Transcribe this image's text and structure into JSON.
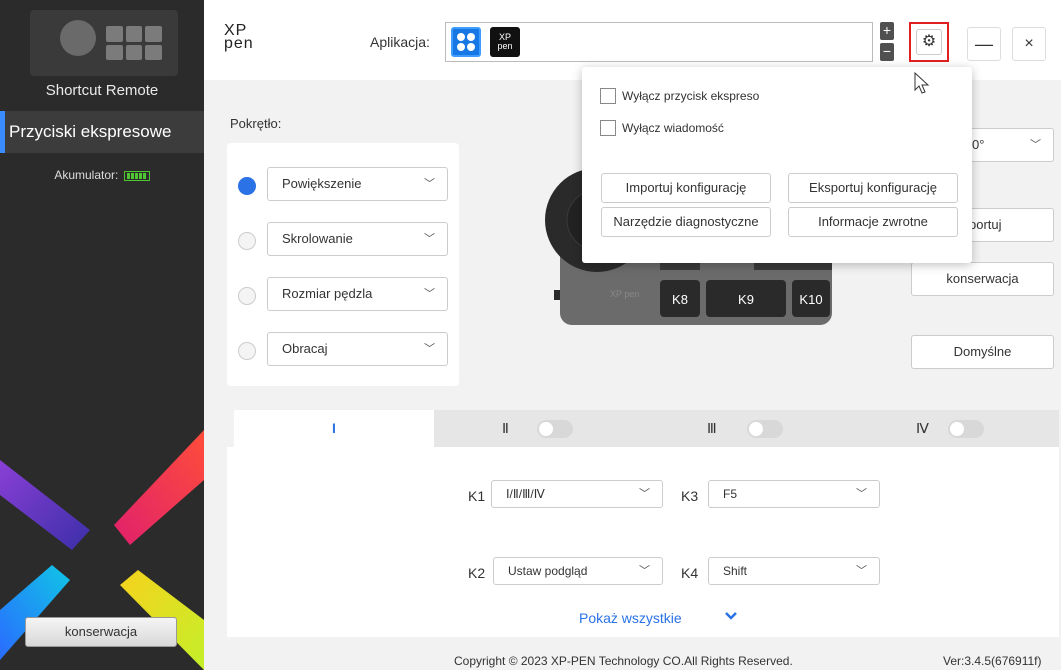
{
  "sidebar": {
    "device_name": "Shortcut Remote",
    "nav_item": "Przyciski ekspresowe",
    "battery_label": "Akumulator:",
    "maintenance_button": "konserwacja"
  },
  "header": {
    "logo_line1": "XP",
    "logo_line2": "pen",
    "app_label": "Aplikacja:",
    "app_icon_2_text_1": "XP",
    "app_icon_2_text_2": "pen",
    "add_symbol": "+",
    "remove_symbol": "−",
    "settings_symbol": "⚙",
    "minimize_symbol": "—",
    "close_symbol": "×"
  },
  "dial": {
    "title": "Pokrętło:",
    "options": [
      {
        "label": "Powiększenie",
        "selected": true
      },
      {
        "label": "Skrolowanie",
        "selected": false
      },
      {
        "label": "Rozmiar pędzla",
        "selected": false
      },
      {
        "label": "Obracaj",
        "selected": false
      }
    ]
  },
  "device_keys": [
    "K8",
    "K9",
    "K10"
  ],
  "device_logo": "XP pen",
  "right_panel": {
    "rotation_value": "0°",
    "export_partial": "portuj",
    "maintenance": "konserwacja",
    "defaults": "Domyślne"
  },
  "tabs": [
    {
      "label": "I",
      "active": true
    },
    {
      "label": "Ⅱ",
      "active": false
    },
    {
      "label": "Ⅲ",
      "active": false
    },
    {
      "label": "Ⅳ",
      "active": false
    }
  ],
  "key_map": {
    "k1": {
      "label": "K1",
      "value": "Ⅰ/Ⅱ/Ⅲ/Ⅳ"
    },
    "k2": {
      "label": "K2",
      "value": "Ustaw podgląd"
    },
    "k3": {
      "label": "K3",
      "value": "F5"
    },
    "k4": {
      "label": "K4",
      "value": "Shift"
    }
  },
  "show_all": "Pokaż wszystkie",
  "footer": {
    "copyright": "Copyright © 2023  XP-PEN Technology CO.All Rights Reserved.",
    "version": "Ver:3.4.5(676911f)"
  },
  "popover": {
    "disable_express_keys": "Wyłącz przycisk ekspreso",
    "disable_message": "Wyłącz wiadomość",
    "import_config": "Importuj konfigurację",
    "export_config": "Eksportuj konfigurację",
    "diagnostic_tool": "Narzędzie diagnostyczne",
    "feedback": "Informacje zwrotne"
  },
  "colors": {
    "accent": "#2a72e6",
    "sidebar_bg": "#2b2b2b",
    "highlight_border": "#e02020",
    "battery": "#4ec631"
  }
}
